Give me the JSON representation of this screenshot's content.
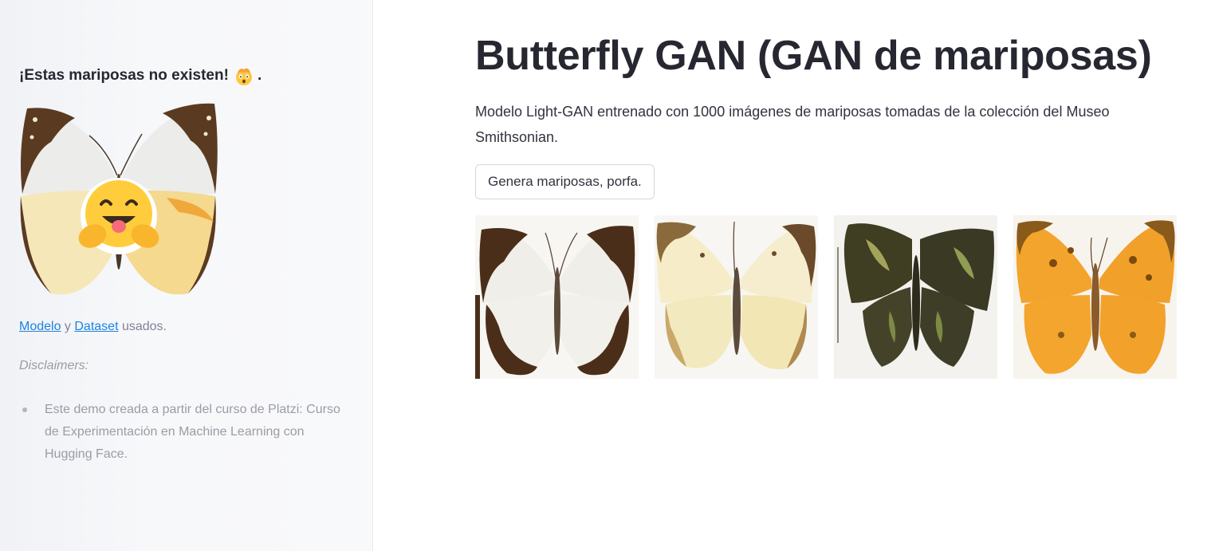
{
  "sidebar": {
    "title": "¡Estas mariposas no existen!",
    "title_suffix": ".",
    "title_icon": "mind-blown-emoji-icon",
    "hero_image": "butterfly-with-hugging-face-icon",
    "link_model": "Modelo",
    "link_y": " y ",
    "link_dataset": "Dataset",
    "link_suffix": " usados.",
    "disclaimers_label": "Disclaimers:",
    "disclaimer_items": [
      "Este demo creada a partir del curso de Platzi: Curso de Experimentación en Machine Learning con Hugging Face."
    ]
  },
  "main": {
    "title": "Butterfly GAN (GAN de mariposas)",
    "description": "Modelo Light-GAN entrenado con 1000 imágenes de mariposas tomadas de la colección del Museo Smithsonian.",
    "button_label": "Genera mariposas, porfa.",
    "gallery": [
      {
        "name": "generated-butterfly-1",
        "palette": "white-brown"
      },
      {
        "name": "generated-butterfly-2",
        "palette": "cream"
      },
      {
        "name": "generated-butterfly-3",
        "palette": "dark-green"
      },
      {
        "name": "generated-butterfly-4",
        "palette": "orange"
      }
    ]
  },
  "colors": {
    "link": "#1c83e1",
    "text": "#31333f",
    "sidebar_bg": "#f0f2f6"
  }
}
